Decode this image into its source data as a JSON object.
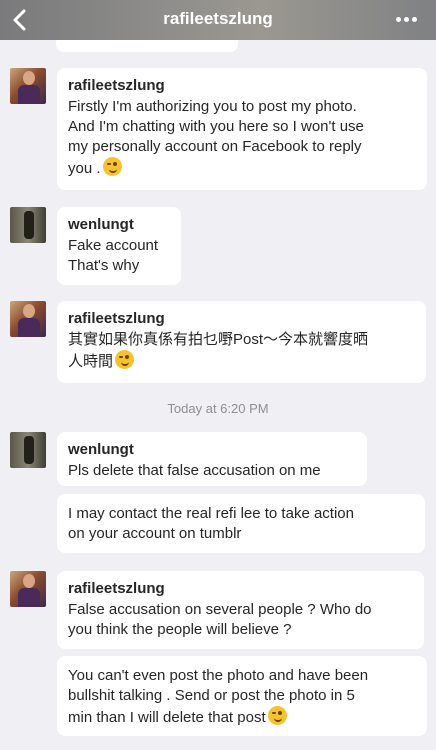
{
  "header": {
    "title": "rafileetszlung"
  },
  "timestamp": "Today at 6:20 PM",
  "messages": [
    {
      "sender": "rafileetszlung",
      "lines": [
        "Firstly I'm authorizing you to post my photo.",
        "And I'm chatting with you here so I won't use",
        "my personally account on Facebook to reply",
        "you ."
      ],
      "emoji": "winking-face"
    },
    {
      "sender": "wenlungt",
      "lines": [
        "Fake account",
        "That's why"
      ]
    },
    {
      "sender": "rafileetszlung",
      "lines": [
        "其實如果你真係有拍乜嘢Post～今本就響度晒",
        "人時間"
      ],
      "emoji": "winking-face"
    },
    {
      "sender": "wenlungt",
      "lines": [
        "Pls delete that false accusation on me"
      ]
    },
    {
      "lines": [
        "I may contact the real refi lee to take action",
        "on your account on tumblr"
      ]
    },
    {
      "sender": "rafileetszlung",
      "lines": [
        "False accusation on several people ? Who do",
        "you think the people will believe ?"
      ]
    },
    {
      "lines": [
        "You can't even post the photo and have been",
        "bullshit talking . Send or post the photo in 5",
        "min than I will delete that post"
      ],
      "emoji": "winking-face"
    }
  ]
}
